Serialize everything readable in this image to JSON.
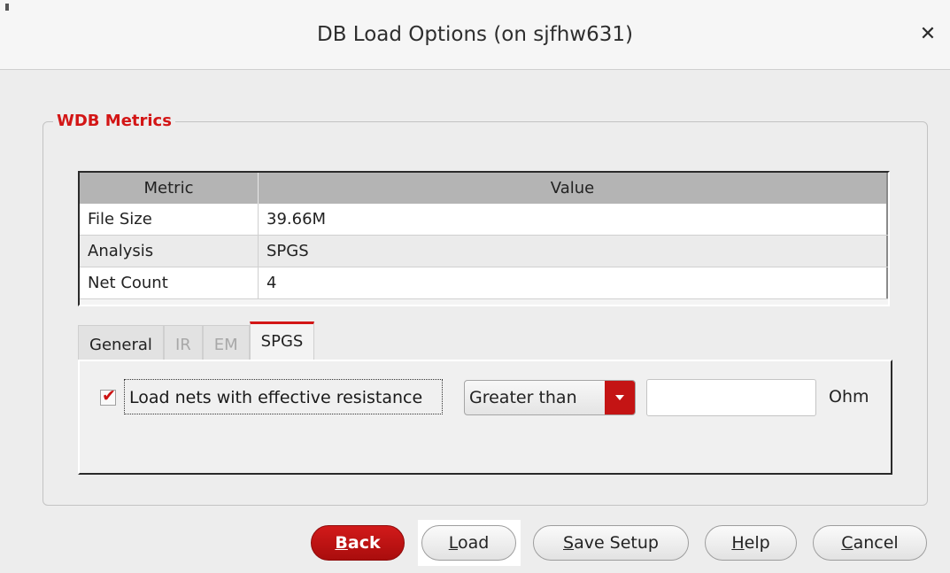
{
  "window": {
    "title": "DB Load Options (on sjfhw631)"
  },
  "group": {
    "title": "WDB Metrics"
  },
  "table": {
    "headers": [
      "Metric",
      "Value"
    ],
    "rows": [
      {
        "metric": "File Size",
        "value": "39.66M"
      },
      {
        "metric": "Analysis",
        "value": "SPGS"
      },
      {
        "metric": "Net Count",
        "value": "4"
      }
    ]
  },
  "tabs": [
    {
      "label": "General",
      "state": "normal"
    },
    {
      "label": "IR",
      "state": "disabled"
    },
    {
      "label": "EM",
      "state": "disabled"
    },
    {
      "label": "SPGS",
      "state": "active"
    }
  ],
  "spgs": {
    "checkbox_label": "Load nets with effective resistance",
    "checked": true,
    "comparison": "Greater than",
    "resistance_value": "",
    "unit": "Ohm"
  },
  "buttons": {
    "back": {
      "mnemonic": "B",
      "rest": "ack"
    },
    "load": {
      "mnemonic": "L",
      "rest": "oad"
    },
    "save_setup": {
      "mnemonic": "S",
      "rest": "ave Setup"
    },
    "help": {
      "mnemonic": "H",
      "rest": "elp"
    },
    "cancel": {
      "mnemonic": "C",
      "rest": "ancel"
    }
  },
  "colors": {
    "accent": "#d31616",
    "primary_button": "#c41414"
  },
  "icons": {
    "close": "close-icon",
    "dropdown": "chevron-down-icon",
    "check": "check-icon"
  }
}
